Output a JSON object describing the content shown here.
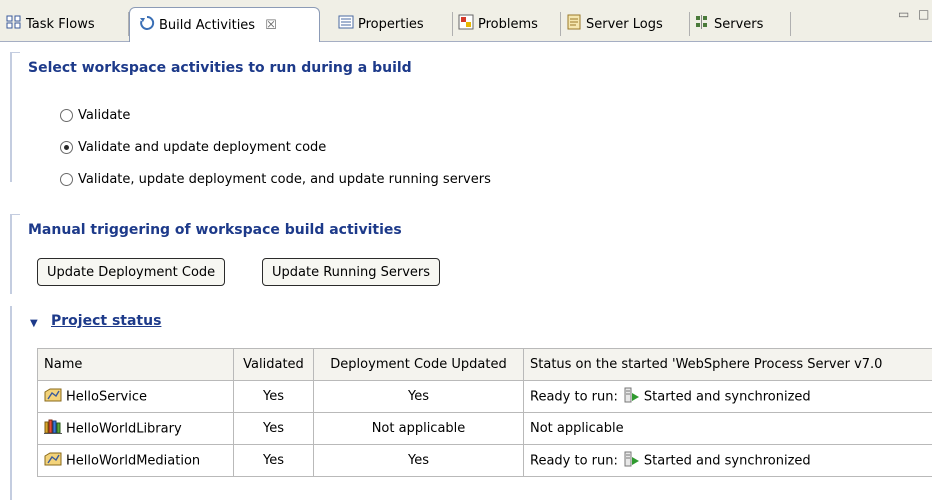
{
  "tabs": [
    {
      "label": "Task Flows",
      "icon": "task-flows-icon"
    },
    {
      "label": "Build Activities",
      "icon": "build-activities-icon",
      "active": true,
      "close_glyph": "☒"
    },
    {
      "label": "Properties",
      "icon": "properties-icon"
    },
    {
      "label": "Problems",
      "icon": "problems-icon"
    },
    {
      "label": "Server Logs",
      "icon": "server-logs-icon"
    },
    {
      "label": "Servers",
      "icon": "servers-icon"
    }
  ],
  "window_controls": {
    "minimize": "▭",
    "maximize": "□"
  },
  "build_section": {
    "title": "Select workspace activities to run during a build",
    "options": [
      {
        "label": "Validate",
        "checked": false
      },
      {
        "label": "Validate and update deployment code",
        "checked": true
      },
      {
        "label": "Validate, update deployment code, and update running servers",
        "checked": false
      }
    ]
  },
  "manual_section": {
    "title": "Manual triggering of workspace build activities",
    "update_deployment_label": "Update Deployment Code",
    "update_servers_label": "Update Running Servers"
  },
  "project_status": {
    "title": "Project status",
    "columns": [
      "Name",
      "Validated",
      "Deployment Code Updated",
      "Status on the started 'WebSphere Process Server v7.0"
    ],
    "rows": [
      {
        "name": "HelloService",
        "icon": "module-icon",
        "validated": "Yes",
        "deploy": "Yes",
        "status_prefix": "Ready to run:",
        "status_text": "Started and synchronized",
        "has_run_icon": true
      },
      {
        "name": "HelloWorldLibrary",
        "icon": "library-icon",
        "validated": "Yes",
        "deploy": "Not applicable",
        "status_prefix": "",
        "status_text": "Not applicable",
        "has_run_icon": false
      },
      {
        "name": "HelloWorldMediation",
        "icon": "module-icon",
        "validated": "Yes",
        "deploy": "Yes",
        "status_prefix": "Ready to run:",
        "status_text": "Started and synchronized",
        "has_run_icon": true
      }
    ]
  },
  "colors": {
    "section_title": "#1d3a8a",
    "tab_bg": "#f0efe6",
    "rule": "#c4cde0"
  }
}
